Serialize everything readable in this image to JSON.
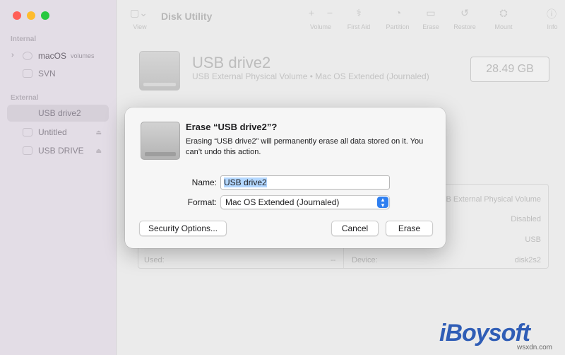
{
  "window": {
    "title": "Disk Utility",
    "traffic_lights": {
      "close": "#ff5f57",
      "minimize": "#febc2e",
      "zoom": "#28c840"
    }
  },
  "toolbar": {
    "view_label": "View",
    "volume_label": "Volume",
    "first_aid_label": "First Aid",
    "partition_label": "Partition",
    "erase_label": "Erase",
    "restore_label": "Restore",
    "mount_label": "Mount",
    "info_label": "Info"
  },
  "sidebar": {
    "internal_heading": "Internal",
    "external_heading": "External",
    "internal_items": [
      {
        "label": "macOS",
        "suffix": "volumes"
      },
      {
        "label": "SVN"
      }
    ],
    "external_items": [
      {
        "label": "USB drive2",
        "selected": true
      },
      {
        "label": "Untitled"
      },
      {
        "label": "USB DRIVE"
      }
    ]
  },
  "drive": {
    "name": "USB drive2",
    "subtitle": "USB External Physical Volume • Mac OS Extended (Journaled)",
    "size": "28.49 GB"
  },
  "info": {
    "type_value": "USB External Physical Volume",
    "owners_value": "Disabled",
    "connection_value": "USB",
    "used_label": "Used:",
    "used_value": "--",
    "device_label": "Device:",
    "device_value": "disk2s2"
  },
  "dialog": {
    "title": "Erase “USB drive2”?",
    "message": "Erasing “USB drive2” will permanently erase all data stored on it. You can’t undo this action.",
    "name_label": "Name:",
    "name_value": "USB drive2",
    "format_label": "Format:",
    "format_value": "Mac OS Extended (Journaled)",
    "security_button": "Security Options...",
    "cancel_button": "Cancel",
    "erase_button": "Erase"
  },
  "watermark": {
    "brand": "iBoysoft",
    "site": "wsxdn.com"
  }
}
